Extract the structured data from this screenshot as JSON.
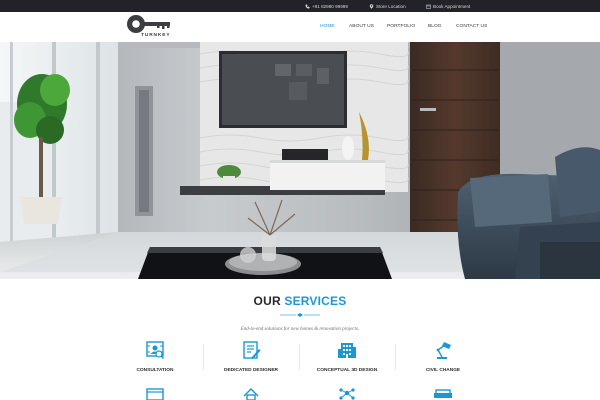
{
  "topbar": {
    "phone": "+91 82980 99999",
    "store": "Store Location",
    "book": "Book Appointment"
  },
  "brand": {
    "name": "TURNKEY"
  },
  "nav": [
    {
      "label": "HOME",
      "active": true
    },
    {
      "label": "ABOUT US",
      "active": false
    },
    {
      "label": "PORTFOLIO",
      "active": false
    },
    {
      "label": "BLOG",
      "active": false
    },
    {
      "label": "CONTACT US",
      "active": false
    }
  ],
  "services": {
    "title_a": "OUR",
    "title_b": "SERVICES",
    "subtitle": "End-to-end solutions for new homes & renovation projects.",
    "items": [
      {
        "label": "CONSULTATION",
        "icon": "consultation-icon"
      },
      {
        "label": "DEDICATED DESIGNER",
        "icon": "designer-icon"
      },
      {
        "label": "CONCEPTUAL 3D DESIGN",
        "icon": "building-3d-icon"
      },
      {
        "label": "CIVIL CHANGE",
        "icon": "lamp-icon"
      }
    ],
    "second_row_icons": [
      "kitchen-icon",
      "home-icon",
      "network-icon",
      "sofa-icon"
    ]
  },
  "colors": {
    "accent": "#1a98d5",
    "topbar_bg": "#222328",
    "title_dark": "#27292e"
  }
}
